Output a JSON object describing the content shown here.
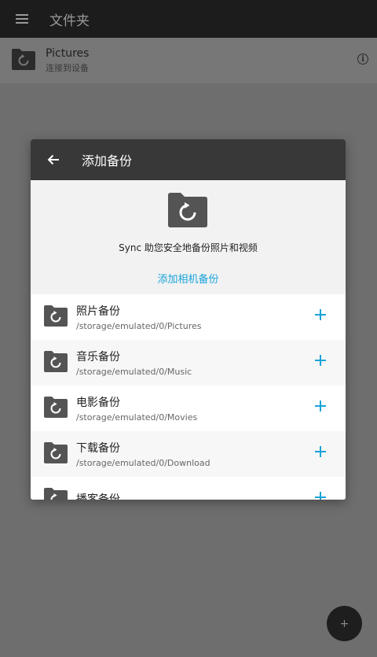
{
  "appbar": {
    "title": "文件夹",
    "menu_icon": "hamburger-menu-icon"
  },
  "folder": {
    "name": "Pictures",
    "status": "连接到设备",
    "icon": "sync-folder-icon",
    "info_icon": "info-icon"
  },
  "fab": {
    "label": "+"
  },
  "dialog": {
    "title": "添加备份",
    "back_icon": "back-arrow-icon",
    "hero": {
      "icon": "sync-folder-icon",
      "description": "Sync 助您安全地备份照片和视频",
      "action": "添加相机备份"
    },
    "items": [
      {
        "name": "照片备份",
        "path": "/storage/emulated/0/Pictures"
      },
      {
        "name": "音乐备份",
        "path": "/storage/emulated/0/Music"
      },
      {
        "name": "电影备份",
        "path": "/storage/emulated/0/Movies"
      },
      {
        "name": "下载备份",
        "path": "/storage/emulated/0/Download"
      },
      {
        "name": "播客备份",
        "path": ""
      }
    ]
  },
  "colors": {
    "accent": "#1aa3d9",
    "header": "#383838",
    "scrim": "#6e6e6e"
  }
}
